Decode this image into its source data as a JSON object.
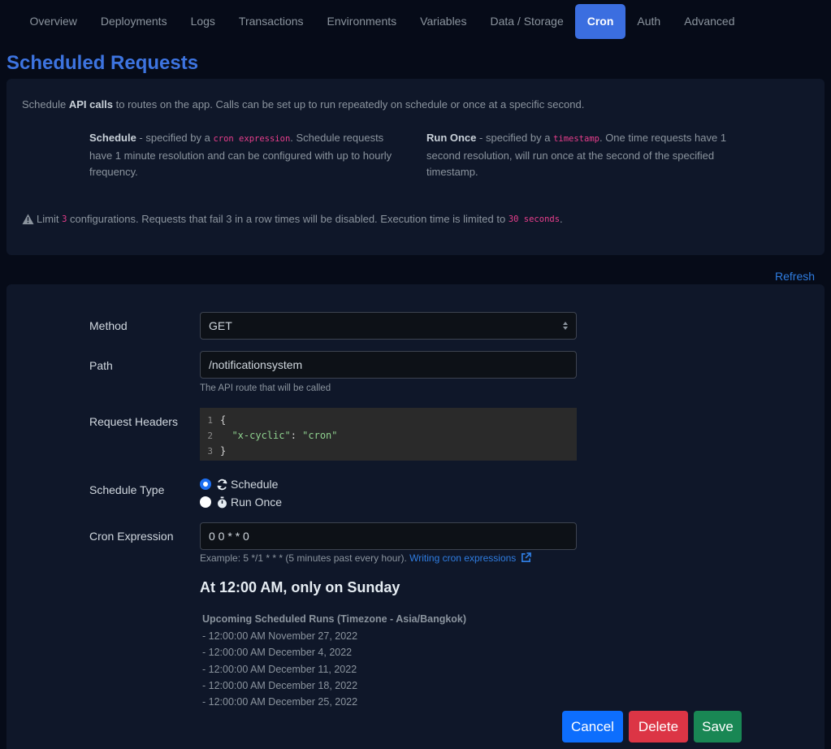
{
  "tabs": [
    {
      "label": "Overview"
    },
    {
      "label": "Deployments"
    },
    {
      "label": "Logs"
    },
    {
      "label": "Transactions"
    },
    {
      "label": "Environments"
    },
    {
      "label": "Variables"
    },
    {
      "label": "Data / Storage"
    },
    {
      "label": "Cron",
      "active": true
    },
    {
      "label": "Auth"
    },
    {
      "label": "Advanced"
    }
  ],
  "page_title": "Scheduled Requests",
  "info": {
    "intro_pre": "Schedule ",
    "intro_bold": "API calls",
    "intro_post": " to routes on the app. Calls can be set up to run repeatedly on schedule or once at a specific second.",
    "schedule": {
      "title": "Schedule",
      "pre": " - specified by a ",
      "code": "cron expression",
      "post": ". Schedule requests have 1 minute resolution and can be configured with up to hourly frequency."
    },
    "run_once": {
      "title": "Run Once",
      "pre": " - specified by a ",
      "code": "timestamp",
      "post": ". One time requests have 1 second resolution, will run once at the second of the specified timestamp."
    },
    "limit_pre": "Limit ",
    "limit_count": "3",
    "limit_mid": " configurations. Requests that fail 3 in a row times will be disabled. Execution time is limited to ",
    "limit_time": "30 seconds",
    "limit_post": "."
  },
  "refresh_label": "Refresh",
  "form": {
    "method_label": "Method",
    "method_value": "GET",
    "path_label": "Path",
    "path_value": "/notificationsystem",
    "path_help": "The API route that will be called",
    "headers_label": "Request Headers",
    "headers_lines": [
      {
        "num": "1",
        "text": "{"
      },
      {
        "num": "2",
        "key": "  \"x-cyclic\"",
        "sep": ": ",
        "val": "\"cron\""
      },
      {
        "num": "3",
        "text": "}"
      }
    ],
    "schedule_type_label": "Schedule Type",
    "schedule_option": "Schedule",
    "run_once_option": "Run Once",
    "selected_type": "Schedule",
    "cron_label": "Cron Expression",
    "cron_value": "0 0 * * 0",
    "cron_help": "Example: 5 */1 * * * (5 minutes past every hour).",
    "cron_link": "Writing cron expressions",
    "human_readable": "At 12:00 AM, only on Sunday",
    "upcoming_title": "Upcoming Scheduled Runs (Timezone - Asia/Bangkok)",
    "upcoming_runs": [
      "- 12:00:00 AM November 27, 2022",
      "- 12:00:00 AM December 4, 2022",
      "- 12:00:00 AM December 11, 2022",
      "- 12:00:00 AM December 18, 2022",
      "- 12:00:00 AM December 25, 2022"
    ],
    "cancel_label": "Cancel",
    "delete_label": "Delete",
    "save_label": "Save"
  },
  "icons": {
    "warning": "warning-triangle-icon",
    "schedule": "sync-icon",
    "run_once": "stopwatch-icon",
    "external_link": "external-link-icon",
    "select": "select-arrows-icon"
  },
  "colors": {
    "accent": "#3b6ee0",
    "title": "#3d74e0",
    "cancel": "#0d6efd",
    "delete": "#dc3545",
    "save": "#198754",
    "code_pink": "#e83e8c"
  }
}
